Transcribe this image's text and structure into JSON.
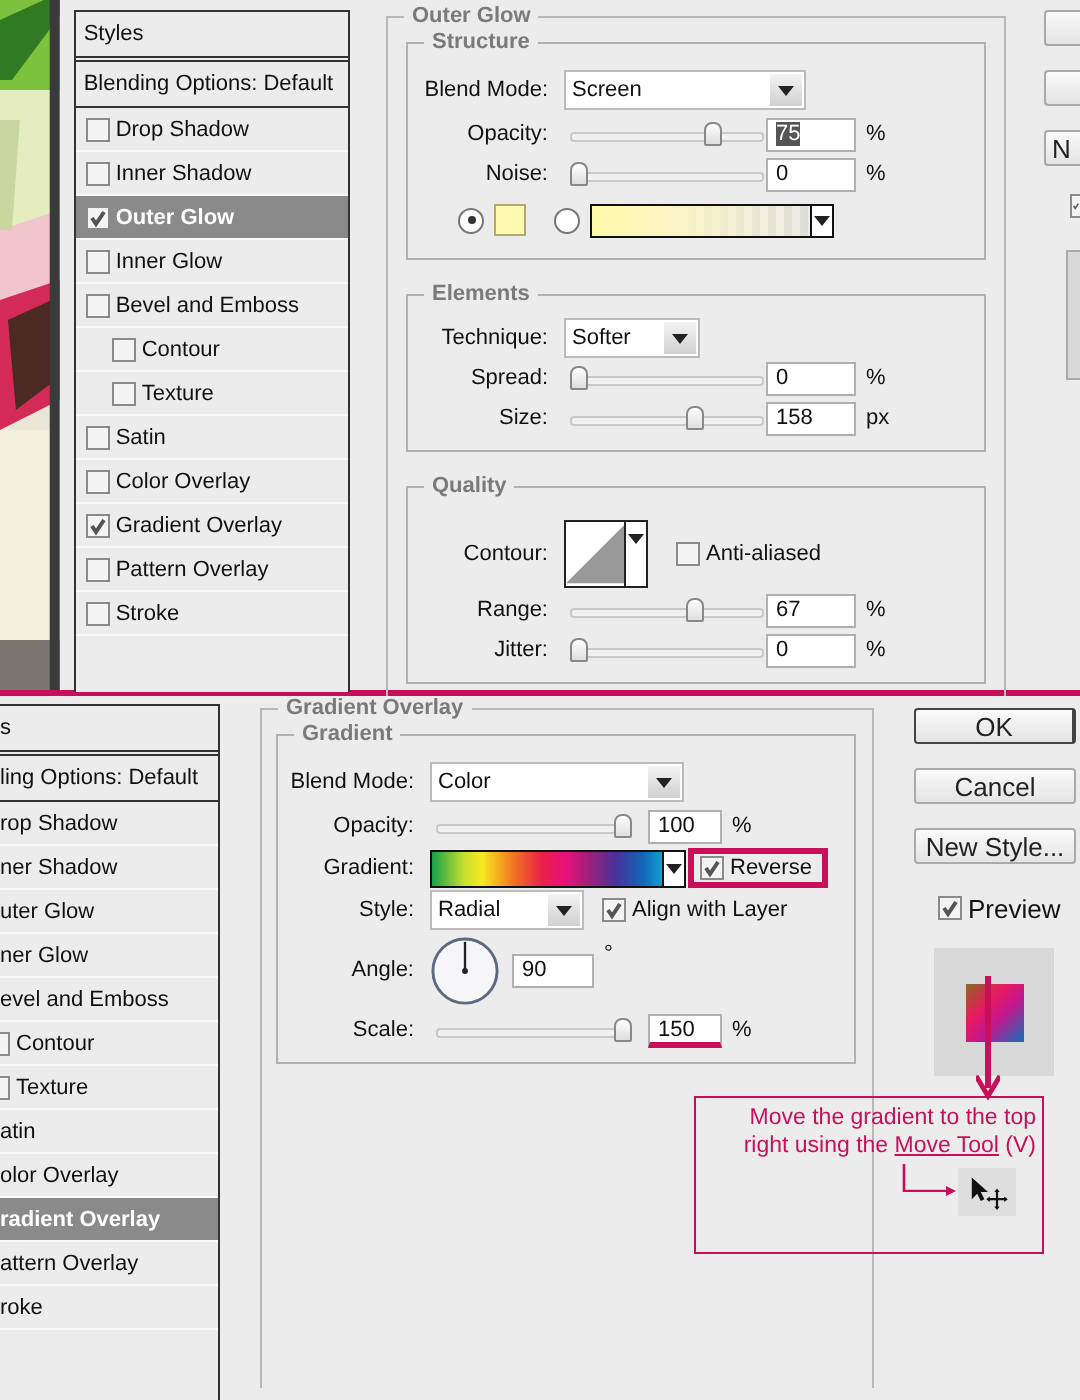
{
  "top": {
    "styles": {
      "header": "Styles",
      "blending": "Blending Options: Default",
      "items": [
        {
          "label": "Drop Shadow",
          "checked": false,
          "selected": false
        },
        {
          "label": "Inner Shadow",
          "checked": false,
          "selected": false
        },
        {
          "label": "Outer Glow",
          "checked": true,
          "selected": true
        },
        {
          "label": "Inner Glow",
          "checked": false,
          "selected": false
        },
        {
          "label": "Bevel and Emboss",
          "checked": false,
          "selected": false,
          "children": [
            {
              "label": "Contour",
              "checked": false,
              "selected": false
            },
            {
              "label": "Texture",
              "checked": false,
              "selected": false
            }
          ]
        },
        {
          "label": "Satin",
          "checked": false,
          "selected": false
        },
        {
          "label": "Color Overlay",
          "checked": false,
          "selected": false
        },
        {
          "label": "Gradient Overlay",
          "checked": true,
          "selected": false
        },
        {
          "label": "Pattern Overlay",
          "checked": false,
          "selected": false
        },
        {
          "label": "Stroke",
          "checked": false,
          "selected": false
        }
      ]
    },
    "pane": {
      "title": "Outer Glow",
      "groups": [
        {
          "title": "Structure",
          "rows": [
            {
              "kind": "dropdown",
              "label": "Blend Mode:",
              "value": "Screen"
            },
            {
              "kind": "slider",
              "label": "Opacity:",
              "value": "75",
              "unit": "%",
              "level": 0.76,
              "text_selected": true
            },
            {
              "kind": "slider",
              "label": "Noise:",
              "value": "0",
              "unit": "%",
              "level": 0
            },
            {
              "kind": "fill",
              "options": [
                {
                  "kind": "swatch",
                  "selected": true
                },
                {
                  "kind": "gradient",
                  "selected": false
                }
              ]
            }
          ]
        },
        {
          "title": "Elements",
          "rows": [
            {
              "kind": "shortdropdown",
              "label": "Technique:",
              "value": "Softer"
            },
            {
              "kind": "slider",
              "label": "Spread:",
              "value": "0",
              "unit": "%",
              "level": 0
            },
            {
              "kind": "slider",
              "label": "Size:",
              "value": "158",
              "unit": "px",
              "level": 0.66
            }
          ]
        },
        {
          "title": "Quality",
          "rows": [
            {
              "kind": "contour",
              "label": "Contour:",
              "option": {
                "label": "Anti-aliased",
                "checked": false
              }
            },
            {
              "kind": "slider",
              "label": "Range:",
              "value": "67",
              "unit": "%",
              "level": 0.66
            },
            {
              "kind": "slider",
              "label": "Jitter:",
              "value": "0",
              "unit": "%",
              "level": 0
            }
          ]
        }
      ]
    },
    "buttons": [
      {
        "kind": "blank"
      },
      {
        "kind": "blank"
      },
      {
        "kind": "text",
        "label": "N",
        "default": false
      }
    ],
    "preview": {
      "checked": true
    }
  },
  "bottom": {
    "styles": {
      "header": "s",
      "blending": "ling Options: Default",
      "items": [
        {
          "label": "rop Shadow",
          "selected": false
        },
        {
          "label": "ner Shadow",
          "selected": false
        },
        {
          "label": "uter Glow",
          "selected": false
        },
        {
          "label": "ner Glow",
          "selected": false
        },
        {
          "label": "evel and Emboss",
          "selected": false,
          "children": [
            {
              "label": "Contour",
              "checked": false,
              "selected": false
            },
            {
              "label": "Texture",
              "checked": false,
              "selected": false
            }
          ]
        },
        {
          "label": "atin",
          "selected": false
        },
        {
          "label": "olor Overlay",
          "selected": false
        },
        {
          "label": "radient Overlay",
          "selected": true
        },
        {
          "label": "attern Overlay",
          "selected": false
        },
        {
          "label": "roke",
          "selected": false
        }
      ]
    },
    "pane": {
      "title": "Gradient Overlay",
      "groups": [
        {
          "title": "Gradient",
          "rows": [
            {
              "kind": "dropdown",
              "label": "Blend Mode:",
              "value": "Color"
            },
            {
              "kind": "slider",
              "label": "Opacity:",
              "value": "100",
              "unit": "%",
              "level": 1
            },
            {
              "kind": "gradient",
              "label": "Gradient:",
              "option": {
                "label": "Reverse",
                "checked": true,
                "highlighted": true
              }
            },
            {
              "kind": "shortdropdown",
              "label": "Style:",
              "value": "Radial",
              "option": {
                "label": "Align with Layer",
                "checked": true
              }
            },
            {
              "kind": "angle",
              "label": "Angle:",
              "value": "90",
              "unit": "°"
            },
            {
              "kind": "slider",
              "label": "Scale:",
              "value": "150",
              "unit": "%",
              "level": 1,
              "highlighted": true
            }
          ]
        }
      ]
    },
    "buttons": [
      {
        "kind": "text",
        "label": "OK",
        "default": true
      },
      {
        "kind": "text",
        "label": "Cancel",
        "default": false
      },
      {
        "kind": "text",
        "label": "New Style...",
        "default": false
      }
    ],
    "preview": {
      "label": "Preview",
      "checked": true
    },
    "annotation": {
      "text_before": "Move the gradient to the top right using the",
      "emphasis": "Move Tool",
      "text_after": "(V)"
    }
  }
}
